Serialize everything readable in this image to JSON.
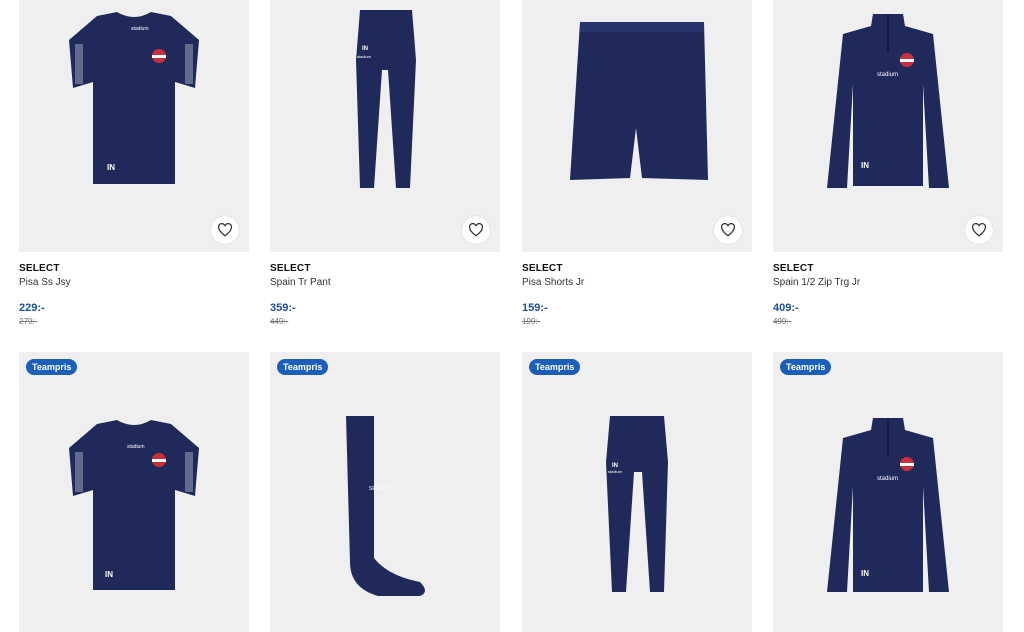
{
  "colors": {
    "navy": "#1f2a5a",
    "price": "#1b4e9a",
    "badge": "#1b5fb9",
    "tile_bg": "#efefef"
  },
  "products": [
    {
      "brand": "SELECT",
      "name": "Pisa Ss Jsy",
      "price": "229:-",
      "old_price": "279:-",
      "image": "jersey"
    },
    {
      "brand": "SELECT",
      "name": "Spain Tr Pant",
      "price": "359:-",
      "old_price": "449:-",
      "image": "pants"
    },
    {
      "brand": "SELECT",
      "name": "Pisa Shorts Jr",
      "price": "159:-",
      "old_price": "199:-",
      "image": "shorts"
    },
    {
      "brand": "SELECT",
      "name": "Spain 1/2 Zip Trg Jr",
      "price": "409:-",
      "old_price": "499:-",
      "image": "zip-top"
    },
    {
      "badge": "Teampris",
      "image": "jersey"
    },
    {
      "badge": "Teampris",
      "image": "sock"
    },
    {
      "badge": "Teampris",
      "image": "pants"
    },
    {
      "badge": "Teampris",
      "image": "zip-top"
    }
  ],
  "garment_print": {
    "initials": "IN",
    "sponsor": "stadium",
    "brand_mark": "SELECT"
  },
  "icons": {
    "favorite": "heart-icon"
  }
}
